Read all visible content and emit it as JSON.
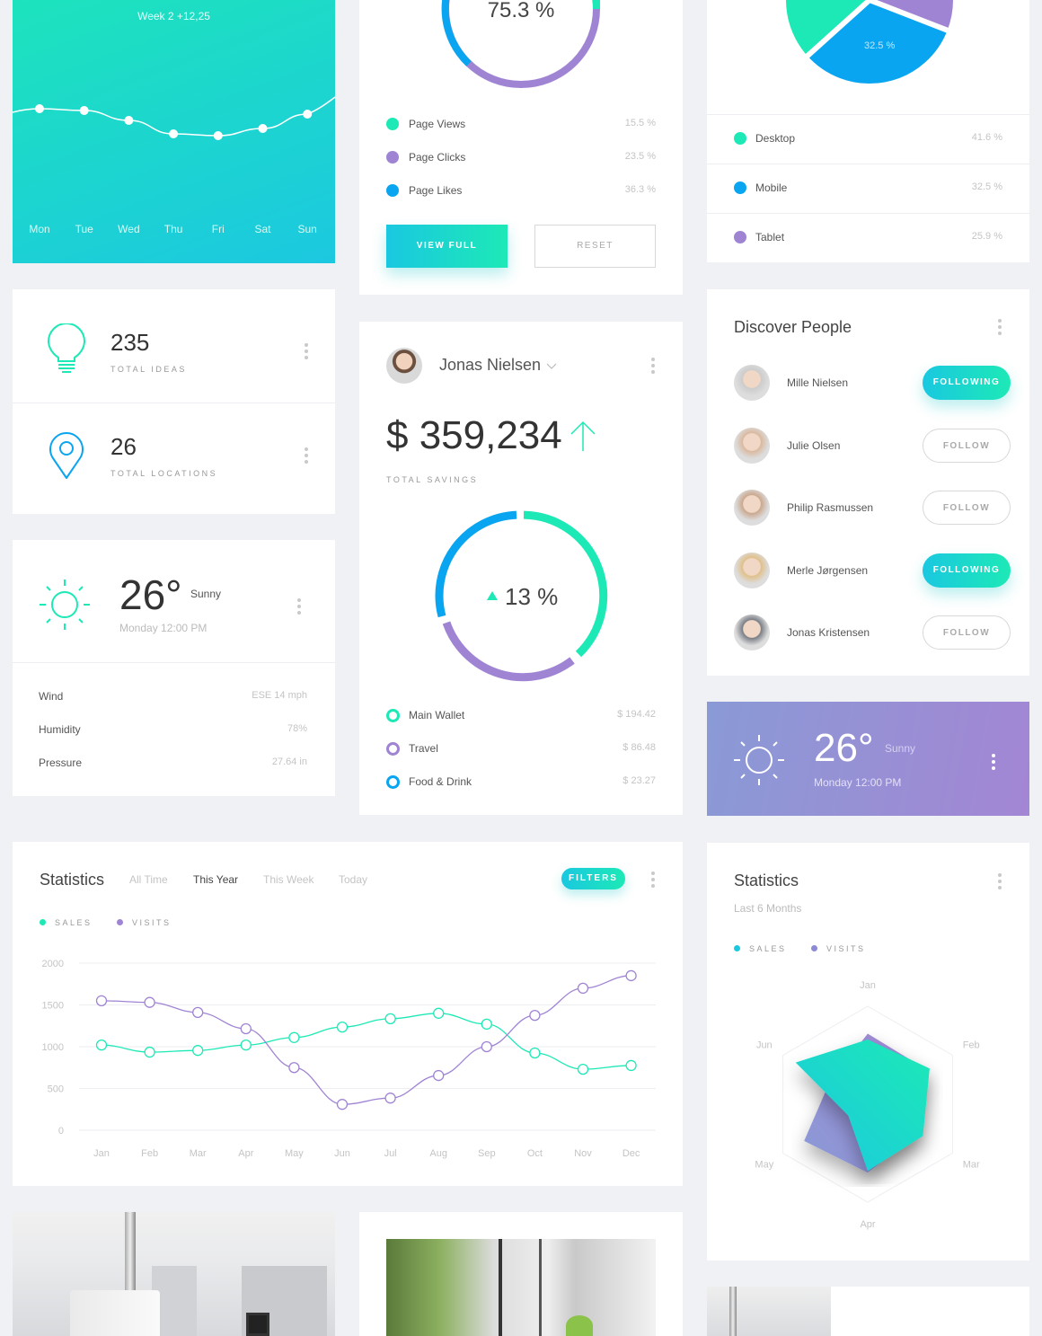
{
  "colors": {
    "teal": "#1de9b6",
    "cyan": "#1ac8e0",
    "purple": "#a084d4",
    "blue": "#0aa5f0",
    "background": "#eff1f5"
  },
  "weekly_card": {
    "subtitle": "Week 2 +12,25",
    "days": [
      "Mon",
      "Tue",
      "Wed",
      "Thu",
      "Fri",
      "Sat",
      "Sun"
    ],
    "levels": [
      121,
      123,
      134,
      149,
      151,
      143,
      127
    ]
  },
  "donut_card": {
    "center_value": "75.3 %",
    "items": [
      {
        "label": "Page Views",
        "value": "15.5 %",
        "color": "#1de9b6"
      },
      {
        "label": "Page Clicks",
        "value": "23.5 %",
        "color": "#a084d4"
      },
      {
        "label": "Page Likes",
        "value": "36.3 %",
        "color": "#0aa5f0"
      }
    ],
    "view_full": "VIEW FULL",
    "reset": "RESET"
  },
  "device_card": {
    "slice_label": "32.5 %",
    "items": [
      {
        "label": "Desktop",
        "value": "41.6 %",
        "pct": 41.6,
        "color": "#1de9b6"
      },
      {
        "label": "Mobile",
        "value": "32.5 %",
        "pct": 32.5,
        "color": "#0aa5f0"
      },
      {
        "label": "Tablet",
        "value": "25.9 %",
        "pct": 25.9,
        "color": "#a084d4"
      }
    ]
  },
  "stats_cards": [
    {
      "value": "235",
      "label": "TOTAL IDEAS",
      "icon": "lightbulb-icon"
    },
    {
      "value": "26",
      "label": "TOTAL LOCATIONS",
      "icon": "location-pin-icon"
    }
  ],
  "weather": {
    "temp": "26°",
    "condition": "Sunny",
    "time": "Monday 12:00 PM",
    "details": [
      {
        "label": "Wind",
        "value": "ESE 14 mph"
      },
      {
        "label": "Humidity",
        "value": "78%"
      },
      {
        "label": "Pressure",
        "value": "27.64 in"
      }
    ]
  },
  "savings": {
    "user": "Jonas Nielsen",
    "amount": "$ 359,234",
    "label": "TOTAL SAVINGS",
    "change": "13 %",
    "items": [
      {
        "label": "Main Wallet",
        "value": "$ 194.42",
        "color": "#1de9b6"
      },
      {
        "label": "Travel",
        "value": "$ 86.48",
        "color": "#a084d4"
      },
      {
        "label": "Food & Drink",
        "value": "$ 23.27",
        "color": "#0aa5f0"
      }
    ]
  },
  "people": {
    "title": "Discover People",
    "list": [
      {
        "name": "Mille Nielsen",
        "button": "FOLLOWING",
        "following": true
      },
      {
        "name": "Julie Olsen",
        "button": "FOLLOW",
        "following": false
      },
      {
        "name": "Philip Rasmussen",
        "button": "FOLLOW",
        "following": false
      },
      {
        "name": "Merle Jørgensen",
        "button": "FOLLOWING",
        "following": true
      },
      {
        "name": "Jonas Kristensen",
        "button": "FOLLOW",
        "following": false
      }
    ]
  },
  "weather2": {
    "temp": "26°",
    "condition": "Sunny",
    "time": "Monday 12:00 PM"
  },
  "statistics": {
    "title": "Statistics",
    "tabs": [
      "All Time",
      "This Year",
      "This Week",
      "Today"
    ],
    "active_tab": "This Year",
    "filters": "FILTERS",
    "legend": [
      "SALES",
      "VISITS"
    ]
  },
  "radar": {
    "title": "Statistics",
    "subtitle": "Last 6 Months",
    "legend": [
      "SALES",
      "VISITS"
    ]
  },
  "chart_data": [
    {
      "type": "line",
      "categories": [
        "Jan",
        "Feb",
        "Mar",
        "Apr",
        "May",
        "Jun",
        "Jul",
        "Aug",
        "Sep",
        "Oct",
        "Nov",
        "Dec"
      ],
      "yticks": [
        0,
        500,
        1000,
        1500,
        2000
      ],
      "ylim": [
        0,
        2000
      ],
      "grid": true,
      "legend": "top-left",
      "series": [
        {
          "name": "SALES",
          "color": "#1de9b6",
          "values": [
            1020,
            935,
            955,
            1020,
            1110,
            1235,
            1335,
            1400,
            1270,
            925,
            730,
            775
          ]
        },
        {
          "name": "VISITS",
          "color": "#a084d4",
          "values": [
            1550,
            1530,
            1410,
            1215,
            750,
            310,
            385,
            655,
            1000,
            1375,
            1700,
            1850
          ]
        }
      ]
    },
    {
      "type": "radar",
      "categories": [
        "Jan",
        "Feb",
        "Mar",
        "Apr",
        "May",
        "Jun"
      ],
      "legend": "top-left",
      "series": [
        {
          "name": "SALES",
          "values": [
            0.66,
            0.73,
            0.65,
            0.68,
            0.23,
            0.85
          ]
        },
        {
          "name": "VISITS",
          "values": [
            0.72,
            0.7,
            0.6,
            0.7,
            0.75,
            0.45
          ]
        }
      ]
    }
  ]
}
